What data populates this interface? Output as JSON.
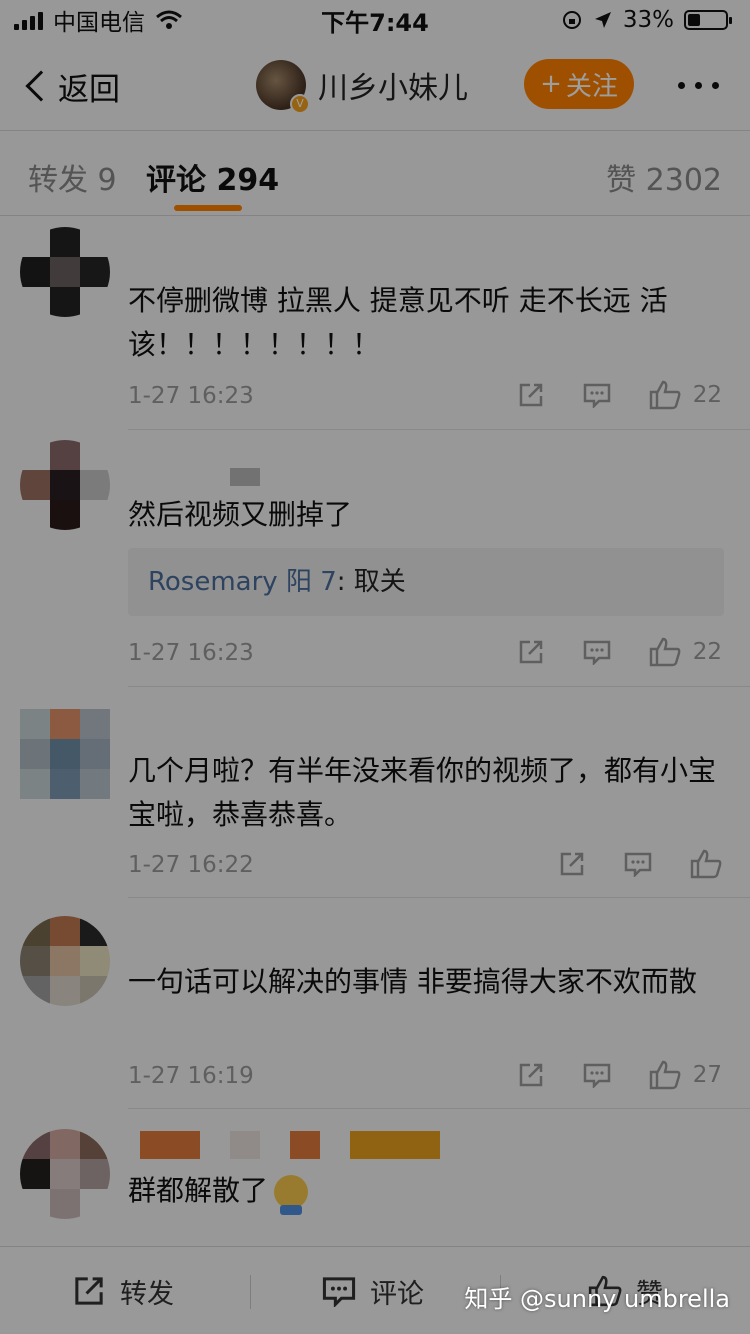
{
  "status_bar": {
    "carrier": "中国电信",
    "time": "下午7:44",
    "battery": "33%",
    "battery_level": 0.33
  },
  "nav": {
    "back_label": "返回",
    "title": "川乡小妹儿",
    "follow_label": "关注",
    "verified_badge": "V"
  },
  "tabs": {
    "repost": "转发 9",
    "comments": "评论 294",
    "likes": "赞 2302"
  },
  "comments": [
    {
      "text": "不停删微博 拉黑人 提意见不听 走不长远 活该！！！！！！！！",
      "time": "1-27 16:23",
      "likes": "22",
      "avatar_colors": [
        "#f5f5f5",
        "#232323",
        "#f5f5f5",
        "#1f1f1f",
        "#6a5f5f",
        "#262626",
        "#f5f5f5",
        "#222222",
        "#f5f5f5"
      ]
    },
    {
      "text": "然后视频又删掉了",
      "time": "1-27 16:23",
      "likes": "22",
      "reply": {
        "name": "Rosemary 阳 7",
        "text": ": 取关"
      },
      "avatar_colors": [
        "#f5f5f5",
        "#8a6a6a",
        "#f5f5f5",
        "#9a7060",
        "#2a1f22",
        "#c7c7c7",
        "#f5f5f5",
        "#2a1a1a",
        "#f5f5f5"
      ]
    },
    {
      "text": "几个月啦？有半年没来看你的视频了，都有小宝宝啦，恭喜恭喜。",
      "time": "1-27 16:22",
      "likes": "",
      "avatar_colors": [
        "#c9d3d6",
        "#e2916a",
        "#b6c1c9",
        "#aebbc6",
        "#6f8ea7",
        "#a3b2bf",
        "#c9d3d6",
        "#7d9ab2",
        "#b9c6cf"
      ]
    },
    {
      "text": "一句话可以解决的事情 非要搞得大家不欢而散",
      "time": "1-27 16:19",
      "likes": "27",
      "avatar_colors": [
        "#7a6a50",
        "#c07a50",
        "#2a2a2a",
        "#8a8070",
        "#e0c0a0",
        "#e8e0c0",
        "#a0a0a0",
        "#ddd6cc",
        "#c8c0b0"
      ]
    },
    {
      "text": "群都解散了",
      "time": "",
      "likes": "",
      "avatar_colors": [
        "#8a6a6a",
        "#d0a8a0",
        "#8a6a5a",
        "#252020",
        "#d8c8c8",
        "#b0a0a0",
        "#f5f5f5",
        "#c8b8b8",
        "#f5f5f5"
      ]
    }
  ],
  "bottom_bar": {
    "repost_label": "转发",
    "comment_label": "评论",
    "like_label": "赞"
  },
  "watermark": "知乎 @sunny umbrella"
}
